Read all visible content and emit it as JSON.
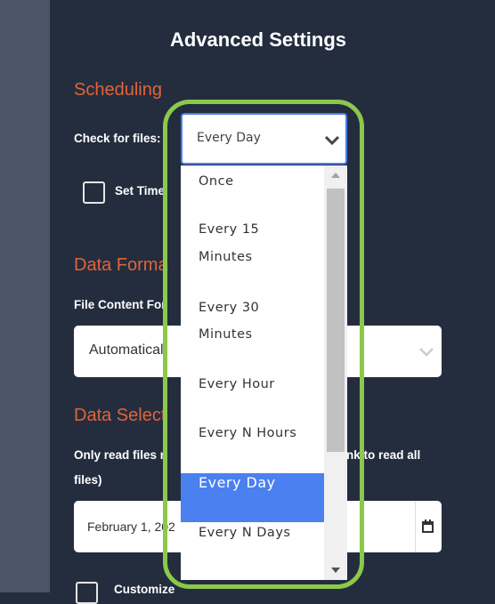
{
  "title": "Advanced Settings",
  "scheduling": {
    "heading": "Scheduling",
    "check_label": "Check for files:",
    "selected": "Every Day",
    "set_time_label": "Set Time"
  },
  "data_format": {
    "heading": "Data Forma",
    "content_label": "File Content For",
    "select_value": "Automaticall"
  },
  "data_selection": {
    "heading": "Data Select",
    "desc_left": "Only read files r",
    "desc_right": "nk to read all",
    "desc_line2": "files)",
    "date_value": "February 1, 202"
  },
  "customize_label": "Customize",
  "dropdown": {
    "options": [
      [
        "Once"
      ],
      [
        "Every 15",
        "Minutes"
      ],
      [
        "Every 30",
        "Minutes"
      ],
      [
        "Every Hour"
      ],
      [
        "Every N Hours"
      ],
      [
        "Every Day"
      ],
      [
        "Every N Days"
      ]
    ],
    "selected_index": 5
  },
  "colors": {
    "accent": "#4a80f0",
    "highlight": "#8cc84b",
    "heading": "#e0643a"
  }
}
